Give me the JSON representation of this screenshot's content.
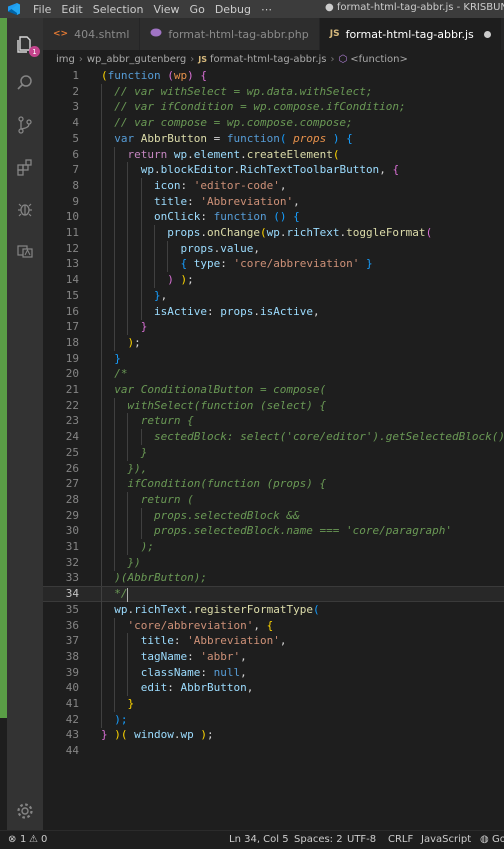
{
  "menu": {
    "items": [
      "File",
      "Edit",
      "Selection",
      "View",
      "Go",
      "Debug",
      "⋯"
    ],
    "window_title": "● format-html-tag-abbr.js - KRISBUNDA"
  },
  "activity_bar": {
    "explorer_badge": "1"
  },
  "tabs": [
    {
      "icon": "<>",
      "label": "404.shtml",
      "icon_color": "#e37933"
    },
    {
      "icon": "php-icon",
      "label": "format-html-tag-abbr.php",
      "icon_color": "#a074c4"
    },
    {
      "icon": "JS",
      "label": "format-html-tag-abbr.js",
      "icon_color": "#d7ba7d",
      "modified": true
    }
  ],
  "breadcrumb": {
    "items": [
      "img",
      "wp_abbr_gutenberg",
      "format-html-tag-abbr.js",
      "<function>"
    ],
    "file_icon": "JS"
  },
  "editor": {
    "current_line": 34,
    "colors": {
      "keyword": "#569cd6",
      "control": "#c586c0",
      "string": "#ce9178",
      "function": "#dcdcaa",
      "variable": "#9cdcfe",
      "comment": "#6a9955",
      "bracket_gold": "#ffd700",
      "bracket_pink": "#da70d6",
      "bracket_blue": "#179fff",
      "highlight": "#e8914b"
    },
    "lines": [
      [
        [
          "(",
          "b1"
        ],
        [
          "function",
          "kw"
        ],
        [
          " ",
          "p"
        ],
        [
          "(",
          "b2"
        ],
        [
          "wp",
          "hl"
        ],
        [
          ")",
          "b2"
        ],
        [
          " ",
          "p"
        ],
        [
          "{",
          "b2"
        ]
      ],
      [
        [
          "  // var withSelect = wp.data.withSelect;",
          "cm"
        ]
      ],
      [
        [
          "  // var ifCondition = wp.compose.ifCondition;",
          "cm"
        ]
      ],
      [
        [
          "  // var compose = wp.compose.compose;",
          "cm"
        ]
      ],
      [
        [
          "  ",
          "p"
        ],
        [
          "var",
          "kw"
        ],
        [
          " ",
          "p"
        ],
        [
          "AbbrButton",
          "fn"
        ],
        [
          " = ",
          "p"
        ],
        [
          "function",
          "kw"
        ],
        [
          "( ",
          "b3"
        ],
        [
          "props",
          "hli"
        ],
        [
          " )",
          "b3"
        ],
        [
          " ",
          "p"
        ],
        [
          "{",
          "b3"
        ]
      ],
      [
        [
          "    ",
          "p"
        ],
        [
          "return",
          "ctl"
        ],
        [
          " ",
          "p"
        ],
        [
          "wp",
          "var"
        ],
        [
          ".",
          "p"
        ],
        [
          "element",
          "var"
        ],
        [
          ".",
          "p"
        ],
        [
          "createElement",
          "fn"
        ],
        [
          "(",
          "b1"
        ]
      ],
      [
        [
          "      ",
          "p"
        ],
        [
          "wp",
          "var"
        ],
        [
          ".",
          "p"
        ],
        [
          "blockEditor",
          "var"
        ],
        [
          ".",
          "p"
        ],
        [
          "RichTextToolbarButton",
          "var"
        ],
        [
          ", ",
          "p"
        ],
        [
          "{",
          "b2"
        ]
      ],
      [
        [
          "        ",
          "p"
        ],
        [
          "icon",
          "var"
        ],
        [
          ": ",
          "p"
        ],
        [
          "'editor-code'",
          "str"
        ],
        [
          ",",
          "p"
        ]
      ],
      [
        [
          "        ",
          "p"
        ],
        [
          "title",
          "var"
        ],
        [
          ": ",
          "p"
        ],
        [
          "'Abbreviation'",
          "str"
        ],
        [
          ",",
          "p"
        ]
      ],
      [
        [
          "        ",
          "p"
        ],
        [
          "onClick",
          "var"
        ],
        [
          ": ",
          "p"
        ],
        [
          "function",
          "kw"
        ],
        [
          " ",
          "p"
        ],
        [
          "()",
          "b3"
        ],
        [
          " ",
          "p"
        ],
        [
          "{",
          "b3"
        ]
      ],
      [
        [
          "          ",
          "p"
        ],
        [
          "props",
          "var"
        ],
        [
          ".",
          "p"
        ],
        [
          "onChange",
          "fn"
        ],
        [
          "(",
          "b1"
        ],
        [
          "wp",
          "var"
        ],
        [
          ".",
          "p"
        ],
        [
          "richText",
          "var"
        ],
        [
          ".",
          "p"
        ],
        [
          "toggleFormat",
          "fn"
        ],
        [
          "(",
          "b2"
        ]
      ],
      [
        [
          "            ",
          "p"
        ],
        [
          "props",
          "var"
        ],
        [
          ".",
          "p"
        ],
        [
          "value",
          "var"
        ],
        [
          ",",
          "p"
        ]
      ],
      [
        [
          "            ",
          "p"
        ],
        [
          "{",
          "b3"
        ],
        [
          " ",
          "p"
        ],
        [
          "type",
          "var"
        ],
        [
          ": ",
          "p"
        ],
        [
          "'core/abbreviation'",
          "str"
        ],
        [
          " ",
          "p"
        ],
        [
          "}",
          "b3"
        ]
      ],
      [
        [
          "          ",
          "p"
        ],
        [
          ")",
          "b2"
        ],
        [
          " ",
          "p"
        ],
        [
          ")",
          "b1"
        ],
        [
          ";",
          "p"
        ]
      ],
      [
        [
          "        ",
          "p"
        ],
        [
          "}",
          "b3"
        ],
        [
          ",",
          "p"
        ]
      ],
      [
        [
          "        ",
          "p"
        ],
        [
          "isActive",
          "var"
        ],
        [
          ": ",
          "p"
        ],
        [
          "props",
          "var"
        ],
        [
          ".",
          "p"
        ],
        [
          "isActive",
          "var"
        ],
        [
          ",",
          "p"
        ]
      ],
      [
        [
          "      ",
          "p"
        ],
        [
          "}",
          "b2"
        ]
      ],
      [
        [
          "    ",
          "p"
        ],
        [
          ")",
          "b1"
        ],
        [
          ";",
          "p"
        ]
      ],
      [
        [
          "  ",
          "p"
        ],
        [
          "}",
          "b3"
        ]
      ],
      [
        [
          "  /*",
          "cm"
        ]
      ],
      [
        [
          "  var ConditionalButton = compose(",
          "cm"
        ]
      ],
      [
        [
          "    withSelect(function (select) {",
          "cm"
        ]
      ],
      [
        [
          "      return {",
          "cm"
        ]
      ],
      [
        [
          "        sectedBlock: select('core/editor').getSelectedBlock()",
          "cm"
        ]
      ],
      [
        [
          "      }",
          "cm"
        ]
      ],
      [
        [
          "    }),",
          "cm"
        ]
      ],
      [
        [
          "    ifCondition(function (props) {",
          "cm"
        ]
      ],
      [
        [
          "      return (",
          "cm"
        ]
      ],
      [
        [
          "        props.selectedBlock &&",
          "cm"
        ]
      ],
      [
        [
          "        props.selectedBlock.name === 'core/paragraph'",
          "cm"
        ]
      ],
      [
        [
          "      );",
          "cm"
        ]
      ],
      [
        [
          "    })",
          "cm"
        ]
      ],
      [
        [
          "  )(AbbrButton);",
          "cm"
        ]
      ],
      [
        [
          "  */",
          "cm"
        ]
      ],
      [
        [
          "  ",
          "p"
        ],
        [
          "wp",
          "var"
        ],
        [
          ".",
          "p"
        ],
        [
          "richText",
          "var"
        ],
        [
          ".",
          "p"
        ],
        [
          "registerFormatType",
          "fn"
        ],
        [
          "(",
          "b3"
        ]
      ],
      [
        [
          "    ",
          "p"
        ],
        [
          "'core/abbreviation'",
          "str"
        ],
        [
          ", ",
          "p"
        ],
        [
          "{",
          "b1"
        ]
      ],
      [
        [
          "      ",
          "p"
        ],
        [
          "title",
          "var"
        ],
        [
          ": ",
          "p"
        ],
        [
          "'Abbreviation'",
          "str"
        ],
        [
          ",",
          "p"
        ]
      ],
      [
        [
          "      ",
          "p"
        ],
        [
          "tagName",
          "var"
        ],
        [
          ": ",
          "p"
        ],
        [
          "'abbr'",
          "str"
        ],
        [
          ",",
          "p"
        ]
      ],
      [
        [
          "      ",
          "p"
        ],
        [
          "className",
          "var"
        ],
        [
          ": ",
          "p"
        ],
        [
          "null",
          "kw"
        ],
        [
          ",",
          "p"
        ]
      ],
      [
        [
          "      ",
          "p"
        ],
        [
          "edit",
          "var"
        ],
        [
          ": ",
          "p"
        ],
        [
          "AbbrButton",
          "var"
        ],
        [
          ",",
          "p"
        ]
      ],
      [
        [
          "    ",
          "p"
        ],
        [
          "}",
          "b1"
        ]
      ],
      [
        [
          "  ",
          "p"
        ],
        [
          ");",
          "b3"
        ]
      ],
      [
        [
          "}",
          "b2"
        ],
        [
          " ",
          "p"
        ],
        [
          ")",
          "b1"
        ],
        [
          "( ",
          "b1"
        ],
        [
          "window",
          "var"
        ],
        [
          ".",
          "p"
        ],
        [
          "wp",
          "var"
        ],
        [
          " )",
          "b1"
        ],
        [
          ";",
          "p"
        ]
      ],
      [
        [
          "",
          "p"
        ]
      ]
    ]
  },
  "status": {
    "errors": "1",
    "warnings": "0",
    "position": "Ln 34, Col 5",
    "spaces": "Spaces: 2",
    "encoding": "UTF-8",
    "eol": "CRLF",
    "language": "JavaScript",
    "extra": "Go"
  }
}
